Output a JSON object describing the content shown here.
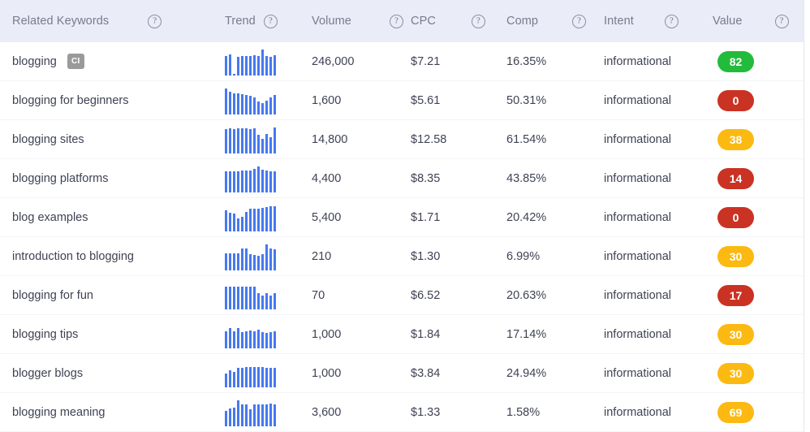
{
  "table": {
    "columns": [
      {
        "key": "keyword",
        "label": "Related Keywords",
        "help_icon": "help-circle-icon"
      },
      {
        "key": "trend",
        "label": "Trend",
        "help_icon": "help-circle-icon"
      },
      {
        "key": "volume",
        "label": "Volume",
        "help_icon": "help-circle-icon"
      },
      {
        "key": "cpc",
        "label": "CPC",
        "help_icon": "help-circle-icon"
      },
      {
        "key": "comp",
        "label": "Comp",
        "help_icon": "help-circle-icon"
      },
      {
        "key": "intent",
        "label": "Intent",
        "help_icon": "help-circle-icon"
      },
      {
        "key": "value",
        "label": "Value",
        "help_icon": "help-circle-icon"
      }
    ],
    "help_glyph": "?",
    "rows": [
      {
        "keyword": "blogging",
        "badge": "CI",
        "trend": [
          74,
          79,
          0,
          71,
          72,
          74,
          73,
          76,
          73,
          100,
          74,
          71,
          76
        ],
        "volume": "246,000",
        "cpc": "$7.21",
        "comp": "16.35%",
        "intent": "informational",
        "value": "82",
        "value_color": "green"
      },
      {
        "keyword": "blogging for beginners",
        "badge": "",
        "trend": [
          100,
          86,
          81,
          80,
          78,
          75,
          70,
          63,
          50,
          41,
          53,
          63,
          72
        ],
        "volume": "1,600",
        "cpc": "$5.61",
        "comp": "50.31%",
        "intent": "informational",
        "value": "0",
        "value_color": "red"
      },
      {
        "keyword": "blogging sites",
        "badge": "",
        "trend": [
          92,
          95,
          93,
          96,
          94,
          95,
          92,
          94,
          70,
          56,
          72,
          60,
          97
        ],
        "volume": "14,800",
        "cpc": "$12.58",
        "comp": "61.54%",
        "intent": "informational",
        "value": "38",
        "value_color": "yellow"
      },
      {
        "keyword": "blogging platforms",
        "badge": "",
        "trend": [
          80,
          80,
          80,
          80,
          83,
          84,
          84,
          88,
          100,
          86,
          83,
          79,
          80
        ],
        "volume": "4,400",
        "cpc": "$8.35",
        "comp": "43.85%",
        "intent": "informational",
        "value": "14",
        "value_color": "red"
      },
      {
        "keyword": "blog examples",
        "badge": "",
        "trend": [
          80,
          71,
          66,
          47,
          56,
          74,
          86,
          87,
          86,
          88,
          93,
          94,
          96
        ],
        "volume": "5,400",
        "cpc": "$1.71",
        "comp": "20.42%",
        "intent": "informational",
        "value": "0",
        "value_color": "red"
      },
      {
        "keyword": "introduction to blogging",
        "badge": "",
        "trend": [
          63,
          63,
          63,
          63,
          82,
          83,
          62,
          57,
          55,
          62,
          100,
          82,
          81
        ],
        "volume": "210",
        "cpc": "$1.30",
        "comp": "6.99%",
        "intent": "informational",
        "value": "30",
        "value_color": "yellow"
      },
      {
        "keyword": "blogging for fun",
        "badge": "",
        "trend": [
          85,
          85,
          85,
          85,
          85,
          85,
          85,
          85,
          62,
          52,
          62,
          52,
          62
        ],
        "volume": "70",
        "cpc": "$6.52",
        "comp": "20.63%",
        "intent": "informational",
        "value": "17",
        "value_color": "red"
      },
      {
        "keyword": "blogging tips",
        "badge": "",
        "trend": [
          64,
          77,
          64,
          78,
          62,
          64,
          66,
          63,
          69,
          62,
          57,
          62,
          64
        ],
        "volume": "1,000",
        "cpc": "$1.84",
        "comp": "17.14%",
        "intent": "informational",
        "value": "30",
        "value_color": "yellow"
      },
      {
        "keyword": "blogger blogs",
        "badge": "",
        "trend": [
          52,
          63,
          59,
          72,
          74,
          76,
          78,
          78,
          77,
          76,
          74,
          73,
          72
        ],
        "volume": "1,000",
        "cpc": "$3.84",
        "comp": "24.94%",
        "intent": "informational",
        "value": "30",
        "value_color": "yellow"
      },
      {
        "keyword": "blogging meaning",
        "badge": "",
        "trend": [
          58,
          68,
          70,
          100,
          82,
          84,
          63,
          84,
          82,
          84,
          82,
          86,
          84
        ],
        "volume": "3,600",
        "cpc": "$1.33",
        "comp": "1.58%",
        "intent": "informational",
        "value": "69",
        "value_color": "yellow"
      }
    ]
  },
  "colors": {
    "header_bg": "#eaecf7",
    "header_text": "#767b90",
    "row_text": "#3f4254",
    "spark_bar": "#4679f0",
    "badge_bg": "#9a9a9a",
    "value_green": "#22bb3b",
    "value_red": "#ca3223",
    "value_yellow": "#fcb912"
  }
}
